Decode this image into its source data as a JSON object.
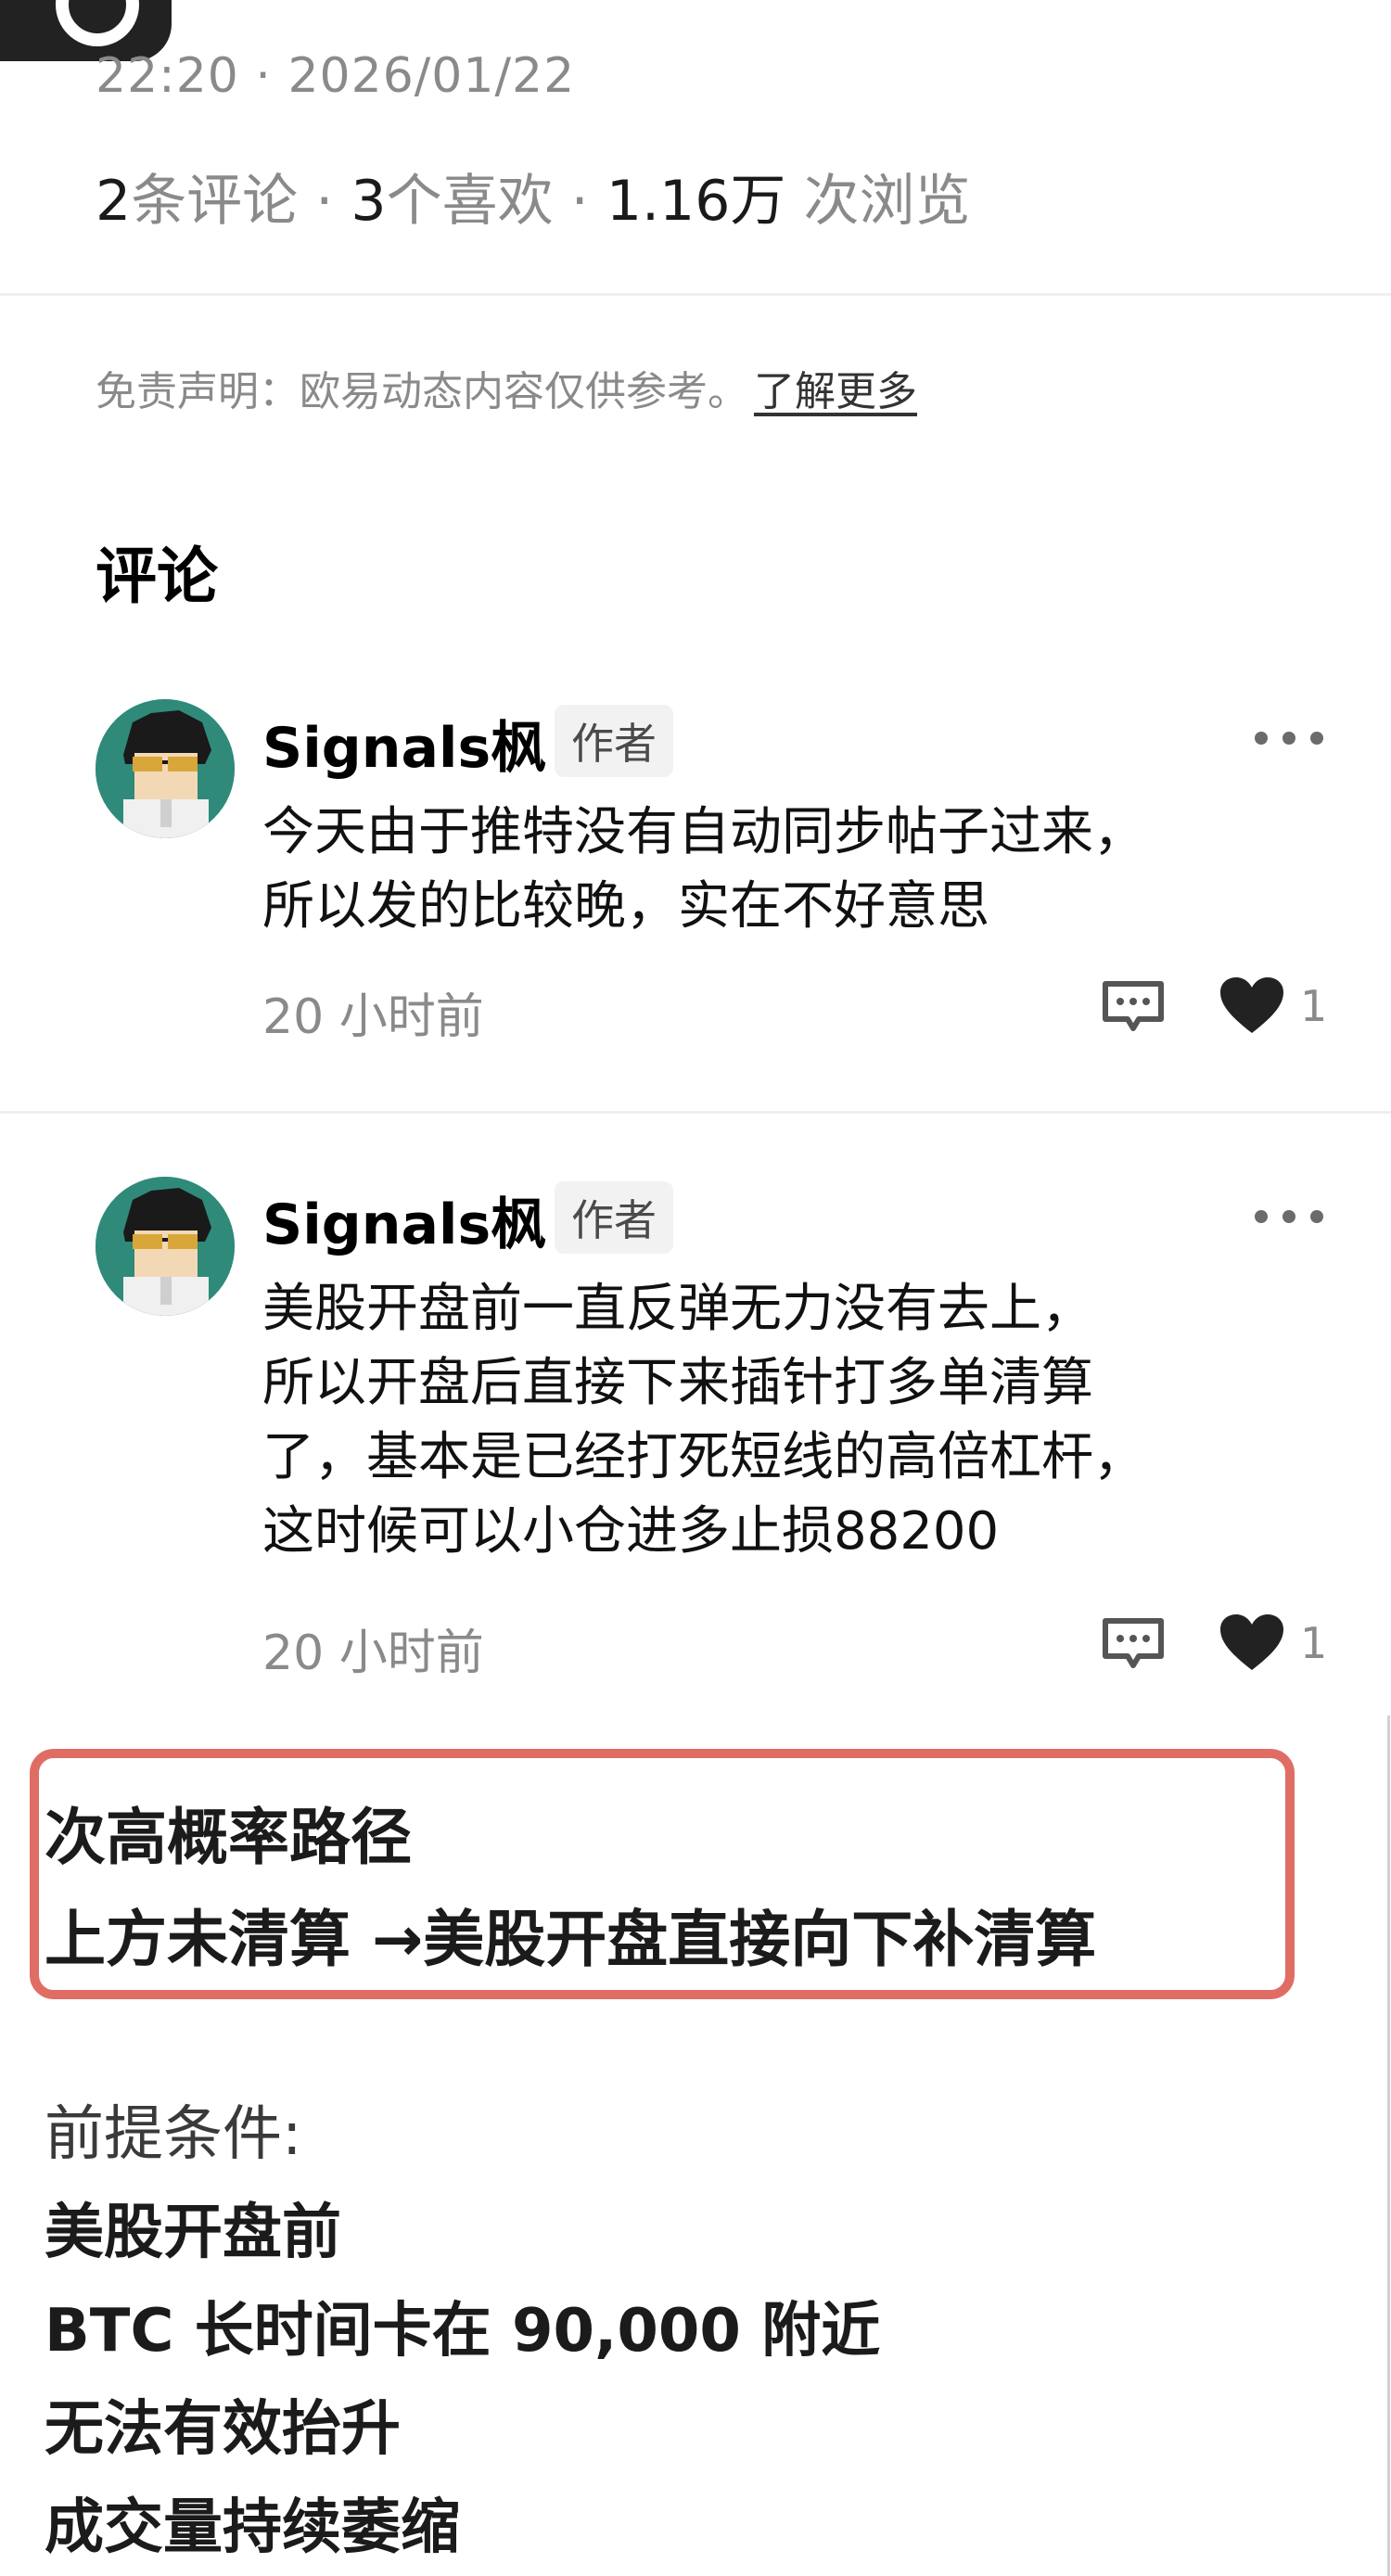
{
  "post_meta": {
    "time": "22:20 · 2026/01/22",
    "comment_count": "2",
    "comment_unit": "条评论 · ",
    "like_count": "3",
    "like_unit": "个喜欢 · ",
    "view_count": "1.16万",
    "view_unit": " 次浏览"
  },
  "disclaimer": {
    "text": "免责声明：欧易动态内容仅供参考。",
    "link": "了解更多"
  },
  "comments_title": "评论",
  "comments": [
    {
      "author": "Signals枫",
      "badge": "作者",
      "lines": [
        "今天由于推特没有自动同步帖子过来，",
        "所以发的比较晚，实在不好意思"
      ],
      "time": "20 小时前",
      "likes": "1"
    },
    {
      "author": "Signals枫",
      "badge": "作者",
      "lines": [
        "美股开盘前一直反弹无力没有去上，",
        "所以开盘后直接下来插针打多单清算",
        "了，基本是已经打死短线的高倍杠杆，",
        "这时候可以小仓进多止损88200"
      ],
      "time": "20 小时前",
      "likes": "1"
    }
  ],
  "attachment": {
    "box_lines": [
      "次高概率路径",
      "上方未清算 →美股开盘直接向下补清算"
    ],
    "conditions_label": "前提条件:",
    "conditions": [
      "美股开盘前",
      "BTC 长时间卡在 90,000 附近",
      "无法有效抬升",
      "成交量持续萎缩"
    ]
  },
  "colors": {
    "quote_border": "#e06d64",
    "avatar_bg": "#2f8a7a",
    "muted_text": "#8a8a8a"
  }
}
